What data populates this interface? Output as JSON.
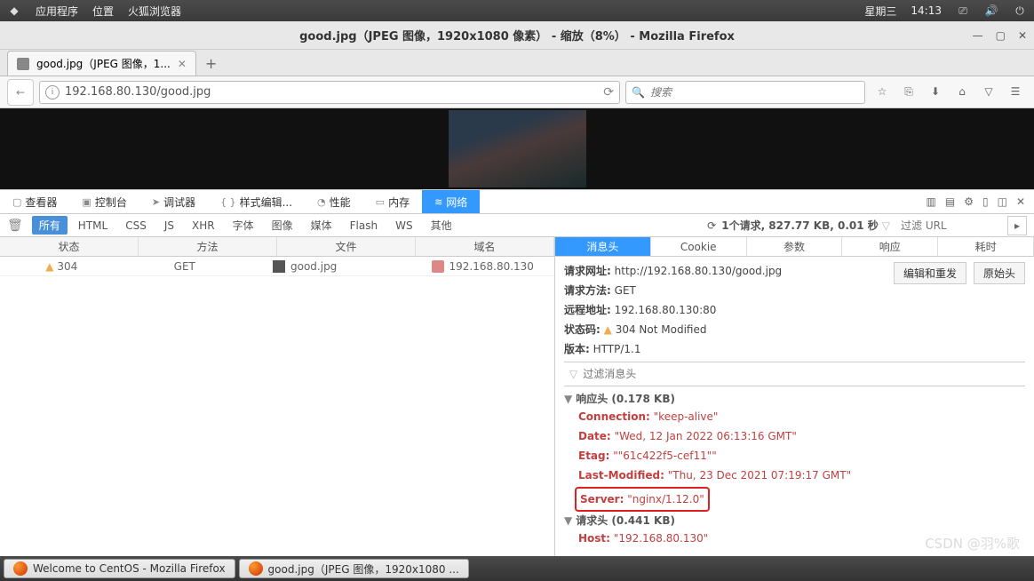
{
  "topbar": {
    "apps": "应用程序",
    "places": "位置",
    "browser": "火狐浏览器",
    "date": "星期三",
    "time": "14:13"
  },
  "window": {
    "title": "good.jpg（JPEG 图像，1920x1080 像素） - 缩放（8%） - Mozilla Firefox"
  },
  "tab": {
    "title": "good.jpg（JPEG 图像，1..."
  },
  "url": {
    "value": "192.168.80.130/good.jpg",
    "search_placeholder": "搜索"
  },
  "devtabs": {
    "inspector": "查看器",
    "console": "控制台",
    "debugger": "调试器",
    "style": "样式编辑...",
    "perf": "性能",
    "memory": "内存",
    "network": "网络"
  },
  "filters": {
    "all": "所有",
    "html": "HTML",
    "css": "CSS",
    "js": "JS",
    "xhr": "XHR",
    "font": "字体",
    "image": "图像",
    "media": "媒体",
    "flash": "Flash",
    "ws": "WS",
    "other": "其他"
  },
  "summary": "1个请求, 827.77 KB, 0.01 秒",
  "filter_url": "过滤 URL",
  "netcols": {
    "status": "状态",
    "method": "方法",
    "file": "文件",
    "domain": "域名"
  },
  "netrow": {
    "status": "304",
    "method": "GET",
    "file": "good.jpg",
    "domain": "192.168.80.130"
  },
  "detailtabs": {
    "headers": "消息头",
    "cookies": "Cookie",
    "params": "参数",
    "response": "响应",
    "timings": "耗时"
  },
  "details": {
    "url_k": "请求网址:",
    "url_v": "http://192.168.80.130/good.jpg",
    "method_k": "请求方法:",
    "method_v": "GET",
    "remote_k": "远程地址:",
    "remote_v": "192.168.80.130:80",
    "status_k": "状态码:",
    "status_v": "304 Not Modified",
    "ver_k": "版本:",
    "ver_v": "HTTP/1.1",
    "edit_btn": "编辑和重发",
    "raw_btn": "原始头",
    "filter_headers": "过滤消息头",
    "resp_sec": "响应头 (0.178 KB)",
    "h_conn_k": "Connection:",
    "h_conn_v": "\"keep-alive\"",
    "h_date_k": "Date:",
    "h_date_v": "\"Wed, 12 Jan 2022 06:13:16 GMT\"",
    "h_etag_k": "Etag:",
    "h_etag_v": "\"\"61c422f5-cef11\"\"",
    "h_lm_k": "Last-Modified:",
    "h_lm_v": "\"Thu, 23 Dec 2021 07:19:17 GMT\"",
    "h_srv_k": "Server:",
    "h_srv_v": "\"nginx/1.12.0\"",
    "req_sec": "请求头 (0.441 KB)",
    "h_host_k": "Host:",
    "h_host_v": "\"192.168.80.130\""
  },
  "taskbar": {
    "b1": "Welcome to CentOS - Mozilla Firefox",
    "b2": "good.jpg（JPEG 图像，1920x1080 ..."
  },
  "watermark": "CSDN @羽%歌"
}
